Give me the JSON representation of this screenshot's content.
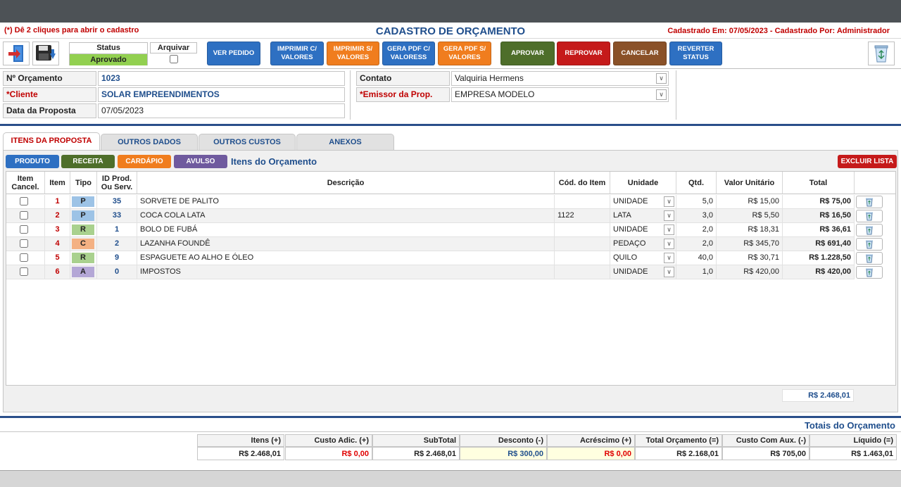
{
  "header": {
    "hint": "(*) Dê 2 cliques para abrir o cadastro",
    "title": "CADASTRO DE ORÇAMENTO",
    "registered_info": "Cadastrado Em: 07/05/2023 - Cadastrado Por: Administrador"
  },
  "status": {
    "label": "Status",
    "value": "Aprovado"
  },
  "archive": {
    "label": "Arquivar"
  },
  "buttons": {
    "view_order": "VER PEDIDO",
    "print_with_values": "IMPRIMIR C/ VALORES",
    "print_without_values": "IMPRIMIR S/ VALORES",
    "pdf_with_values": "GERA PDF C/ VALORESS",
    "pdf_without_values": "GERA PDF S/ VALORES",
    "approve": "APROVAR",
    "reject": "REPROVAR",
    "cancel": "CANCELAR",
    "revert_status": "REVERTER STATUS"
  },
  "form": {
    "quote_no_label": "Nº Orçamento",
    "quote_no": "1023",
    "client_label": "*Cliente",
    "client": "SOLAR EMPREENDIMENTOS",
    "date_label": "Data da Proposta",
    "date": "07/05/2023",
    "contact_label": "Contato",
    "contact": "Valquiria Hermens",
    "issuer_label": "*Emissor da Prop.",
    "issuer": "EMPRESA MODELO"
  },
  "tabs": [
    "ITENS DA PROPOSTA",
    "OUTROS DADOS",
    "OUTROS CUSTOS",
    "ANEXOS"
  ],
  "sub_buttons": {
    "product": "PRODUTO",
    "recipe": "RECEITA",
    "menu": "CARDÁPIO",
    "single": "AVULSO",
    "items_title": "Itens do Orçamento",
    "delete_list": "EXCLUIR LISTA"
  },
  "table": {
    "headers": {
      "cancel": "Item Cancel.",
      "item": "Item",
      "type": "Tipo",
      "id": "ID Prod. Ou Serv.",
      "desc": "Descrição",
      "code": "Cód. do Item",
      "unit": "Unidade",
      "qty": "Qtd.",
      "unit_price": "Valor Unitário",
      "total": "Total"
    },
    "rows": [
      {
        "item": "1",
        "type": "P",
        "id": "35",
        "desc": "SORVETE DE PALITO",
        "code": "",
        "unit": "UNIDADE",
        "qty": "5,0",
        "unit_price": "R$ 15,00",
        "total": "R$ 75,00"
      },
      {
        "item": "2",
        "type": "P",
        "id": "33",
        "desc": "COCA COLA LATA",
        "code": "1122",
        "unit": "LATA",
        "qty": "3,0",
        "unit_price": "R$ 5,50",
        "total": "R$ 16,50"
      },
      {
        "item": "3",
        "type": "R",
        "id": "1",
        "desc": "BOLO DE FUBÁ",
        "code": "",
        "unit": "UNIDADE",
        "qty": "2,0",
        "unit_price": "R$ 18,31",
        "total": "R$ 36,61"
      },
      {
        "item": "4",
        "type": "C",
        "id": "2",
        "desc": "LAZANHA FOUNDÊ",
        "code": "",
        "unit": "PEDAÇO",
        "qty": "2,0",
        "unit_price": "R$ 345,70",
        "total": "R$ 691,40"
      },
      {
        "item": "5",
        "type": "R",
        "id": "9",
        "desc": "ESPAGUETE AO ALHO E ÓLEO",
        "code": "",
        "unit": "QUILO",
        "qty": "40,0",
        "unit_price": "R$ 30,71",
        "total": "R$ 1.228,50"
      },
      {
        "item": "6",
        "type": "A",
        "id": "0",
        "desc": "IMPOSTOS",
        "code": "",
        "unit": "UNIDADE",
        "qty": "1,0",
        "unit_price": "R$ 420,00",
        "total": "R$ 420,00"
      }
    ],
    "grand_total": "R$ 2.468,01"
  },
  "type_colors": {
    "P": "#9dc3e6",
    "R": "#a9d18e",
    "C": "#f4b183",
    "A": "#b4a7d6"
  },
  "totals": {
    "title": "Totais do Orçamento",
    "headers": [
      "Itens (+)",
      "Custo Adic. (+)",
      "SubTotal",
      "Desconto (-)",
      "Acréscimo (+)",
      "Total Orçamento (=)",
      "Custo Com Aux. (-)",
      "Líquido (=)"
    ],
    "values": [
      "R$ 2.468,01",
      "R$ 0,00",
      "R$ 2.468,01",
      "R$ 300,00",
      "R$ 0,00",
      "R$ 2.168,01",
      "R$ 705,00",
      "R$ 1.463,01"
    ]
  }
}
